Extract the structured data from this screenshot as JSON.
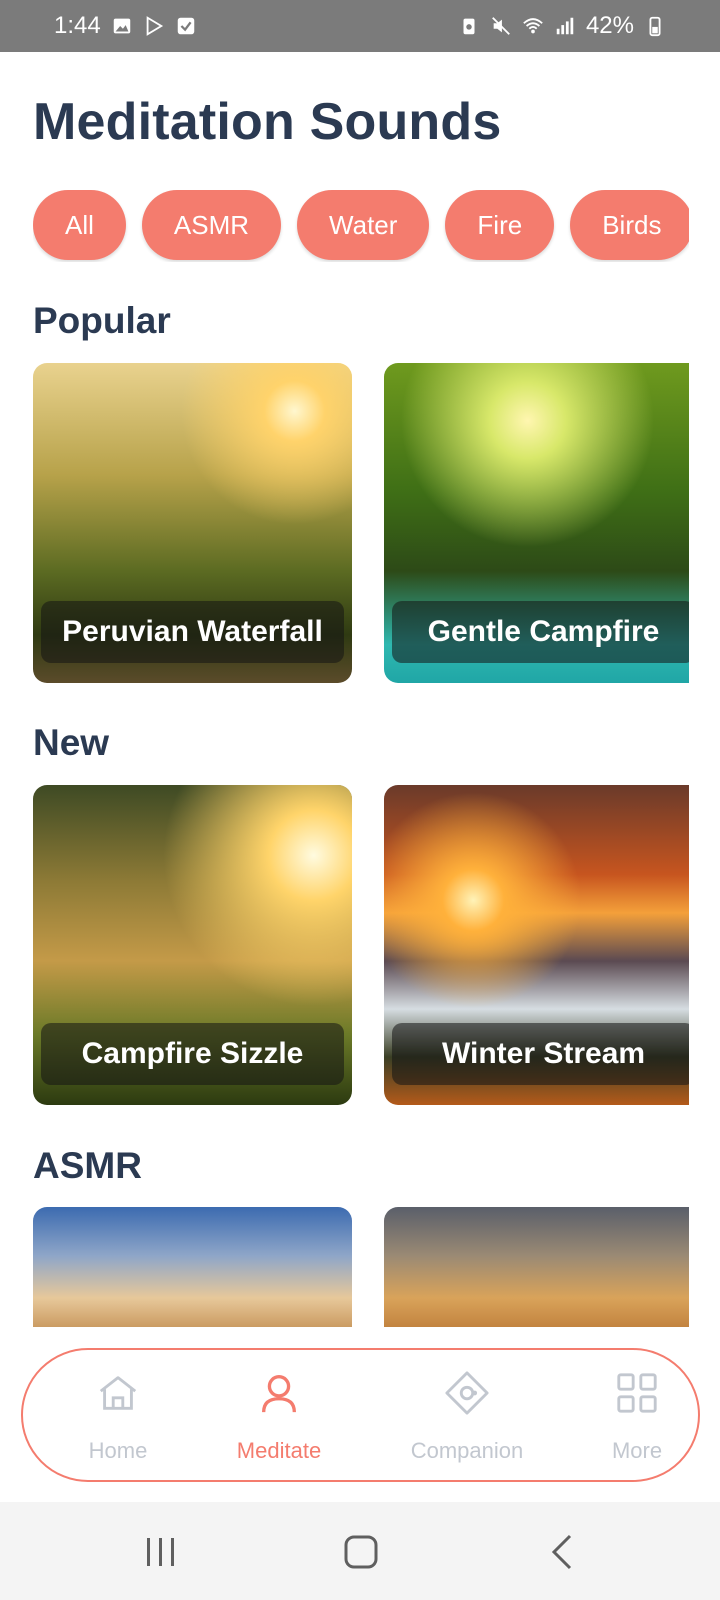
{
  "status_bar": {
    "time": "1:44",
    "battery": "42%"
  },
  "page": {
    "title": "Meditation Sounds"
  },
  "filters": [
    {
      "label": "All"
    },
    {
      "label": "ASMR"
    },
    {
      "label": "Water"
    },
    {
      "label": "Fire"
    },
    {
      "label": "Birds"
    }
  ],
  "sections": [
    {
      "title": "Popular",
      "cards": [
        {
          "title": "Peruvian Waterfall"
        },
        {
          "title": "Gentle Campfire"
        }
      ]
    },
    {
      "title": "New",
      "cards": [
        {
          "title": "Campfire Sizzle"
        },
        {
          "title": "Winter Stream"
        }
      ]
    },
    {
      "title": "ASMR",
      "cards": [
        {
          "title": ""
        },
        {
          "title": ""
        }
      ]
    }
  ],
  "bottom_nav": {
    "items": [
      {
        "label": "Home",
        "icon": "home-icon"
      },
      {
        "label": "Meditate",
        "icon": "person-icon",
        "active": true
      },
      {
        "label": "Companion",
        "icon": "companion-icon"
      },
      {
        "label": "More",
        "icon": "grid-icon"
      }
    ]
  },
  "colors": {
    "accent": "#f47c6e",
    "title": "#2b3a52",
    "inactive": "#c2c7cf"
  }
}
